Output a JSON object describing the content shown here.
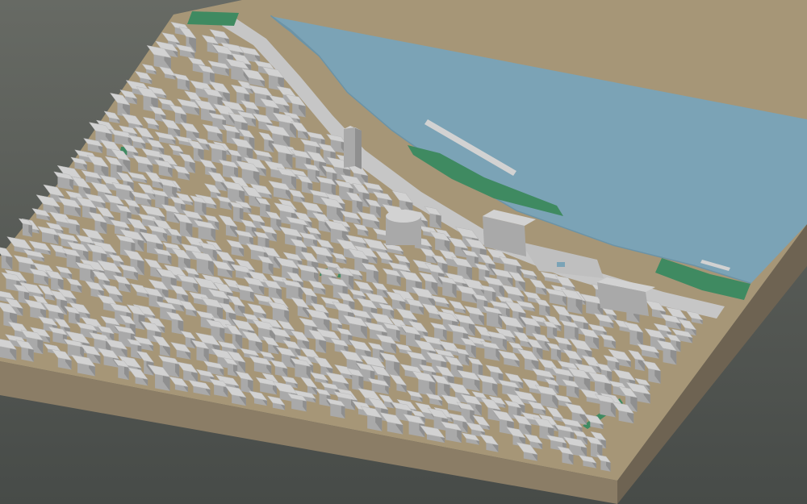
{
  "scene": {
    "subject": "3d-city-block-model",
    "colors": {
      "background_top": "#676a64",
      "background_bottom": "#474b48",
      "base_side": "#8b7d66",
      "base_side_dark": "#6e6352",
      "ground": "#a69677",
      "water": "#7ba3b6",
      "water_edge": "#6c93a6",
      "park": "#3f8a61",
      "park_dark": "#2f6f4c",
      "building_top": "#d2d2d2",
      "building_side": "#a9a9a9",
      "building_shadow": "#8f8f8f",
      "road": "#c6c6c6",
      "plaza": "#bfbfbf"
    }
  }
}
